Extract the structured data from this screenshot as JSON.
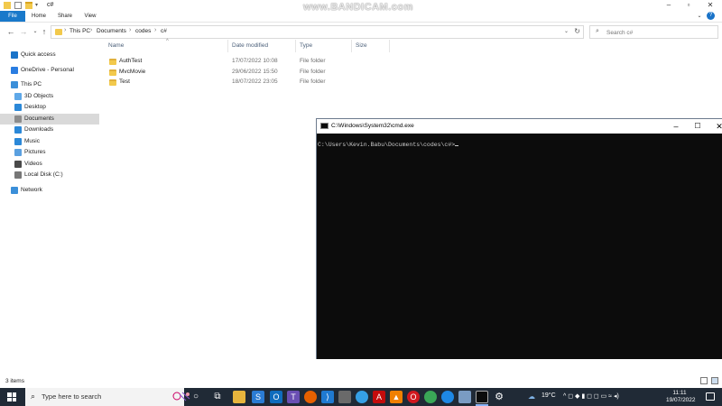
{
  "watermark": "www.BANDICAM.com",
  "explorer": {
    "title": "c#",
    "ribbon_tabs": [
      "File",
      "Home",
      "Share",
      "View"
    ],
    "address": {
      "crumbs": [
        "This PC",
        "Documents",
        "codes",
        "c#"
      ]
    },
    "search": {
      "placeholder": "Search c#"
    },
    "nav": [
      {
        "label": "Quick access",
        "icon": "star-icon",
        "color": "#1a73c8"
      },
      {
        "label": "OneDrive - Personal",
        "icon": "cloud-icon",
        "color": "#2a7de1"
      },
      {
        "label": "This PC",
        "icon": "computer-icon",
        "color": "#3b8fd9"
      },
      {
        "label": "3D Objects",
        "icon": "cube-icon",
        "color": "#5fa8e8"
      },
      {
        "label": "Desktop",
        "icon": "desktop-icon",
        "color": "#2b88d8"
      },
      {
        "label": "Documents",
        "icon": "document-icon",
        "color": "#8c8c8c"
      },
      {
        "label": "Downloads",
        "icon": "download-icon",
        "color": "#2b88d8"
      },
      {
        "label": "Music",
        "icon": "music-icon",
        "color": "#2b88d8"
      },
      {
        "label": "Pictures",
        "icon": "picture-icon",
        "color": "#5aa0e0"
      },
      {
        "label": "Videos",
        "icon": "video-icon",
        "color": "#4a4a4a"
      },
      {
        "label": "Local Disk (C:)",
        "icon": "disk-icon",
        "color": "#777777"
      },
      {
        "label": "Network",
        "icon": "network-icon",
        "color": "#3b8fd9"
      }
    ],
    "columns": [
      "Name",
      "Date modified",
      "Type",
      "Size"
    ],
    "rows": [
      {
        "name": "AuthTest",
        "date": "17/07/2022 10:08",
        "type": "File folder"
      },
      {
        "name": "MvcMovie",
        "date": "29/06/2022 15:50",
        "type": "File folder"
      },
      {
        "name": "Test",
        "date": "18/07/2022 23:05",
        "type": "File folder"
      }
    ],
    "status": "3 items"
  },
  "cmd": {
    "title": "C:\\Windows\\System32\\cmd.exe",
    "prompt": "C:\\Users\\Kevin.Babu\\Documents\\codes\\c#>"
  },
  "taskbar": {
    "search_placeholder": "Type here to search",
    "weather": "19°C",
    "time": "11:11",
    "date": "19/07/2022"
  }
}
